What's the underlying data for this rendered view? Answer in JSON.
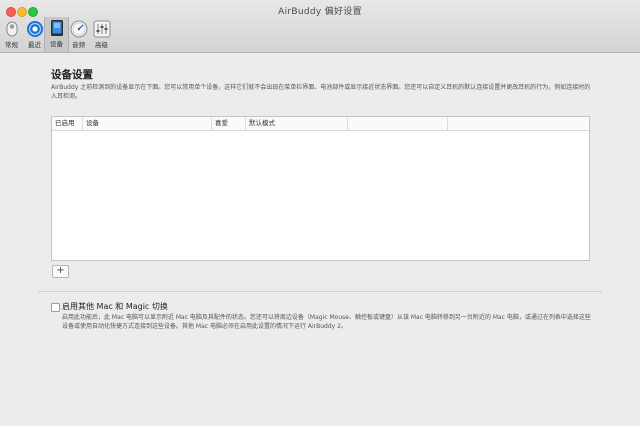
{
  "window": {
    "title": "AirBuddy 偏好设置"
  },
  "tabs": [
    {
      "label": "常规",
      "icon": "toggle-icon"
    },
    {
      "label": "最近",
      "icon": "recent-icon"
    },
    {
      "label": "设备",
      "icon": "devices-icon",
      "active": true
    },
    {
      "label": "音频",
      "icon": "audio-gauge-icon"
    },
    {
      "label": "高级",
      "icon": "sliders-icon"
    }
  ],
  "devices": {
    "title": "设备设置",
    "description": "AirBuddy 之前检测到的设备显示在下面。您可以禁用单个设备，这样它们就不会出现在菜单栏界面、电池部件或显示接近状态界面。您还可以自定义耳机的默认连接设置并更改耳机的行为，例如连接时的入耳检测。",
    "columns": [
      "已启用",
      "设备",
      "喜爱",
      "默认模式"
    ],
    "rows": [],
    "add_label": "+"
  },
  "magic_switch": {
    "checked": false,
    "label": "启用其他 Mac 和 Magic 切换",
    "description": "启用此功能后，此 Mac 电脑可以显示附近 Mac 电脑及其配件的状态。您还可以将周边设备（Magic Mouse、触控板或键盘）从该 Mac 电脑转移到另一台附近的 Mac 电脑，或通过在列表中选择这些设备或使用自动化快捷方式连接到这些设备。其他 Mac 电脑必须在启用此设置的情况下运行 AirBuddy 2。"
  },
  "colors": {
    "accent": "#2a7ae2",
    "window_bg": "#ececec"
  }
}
